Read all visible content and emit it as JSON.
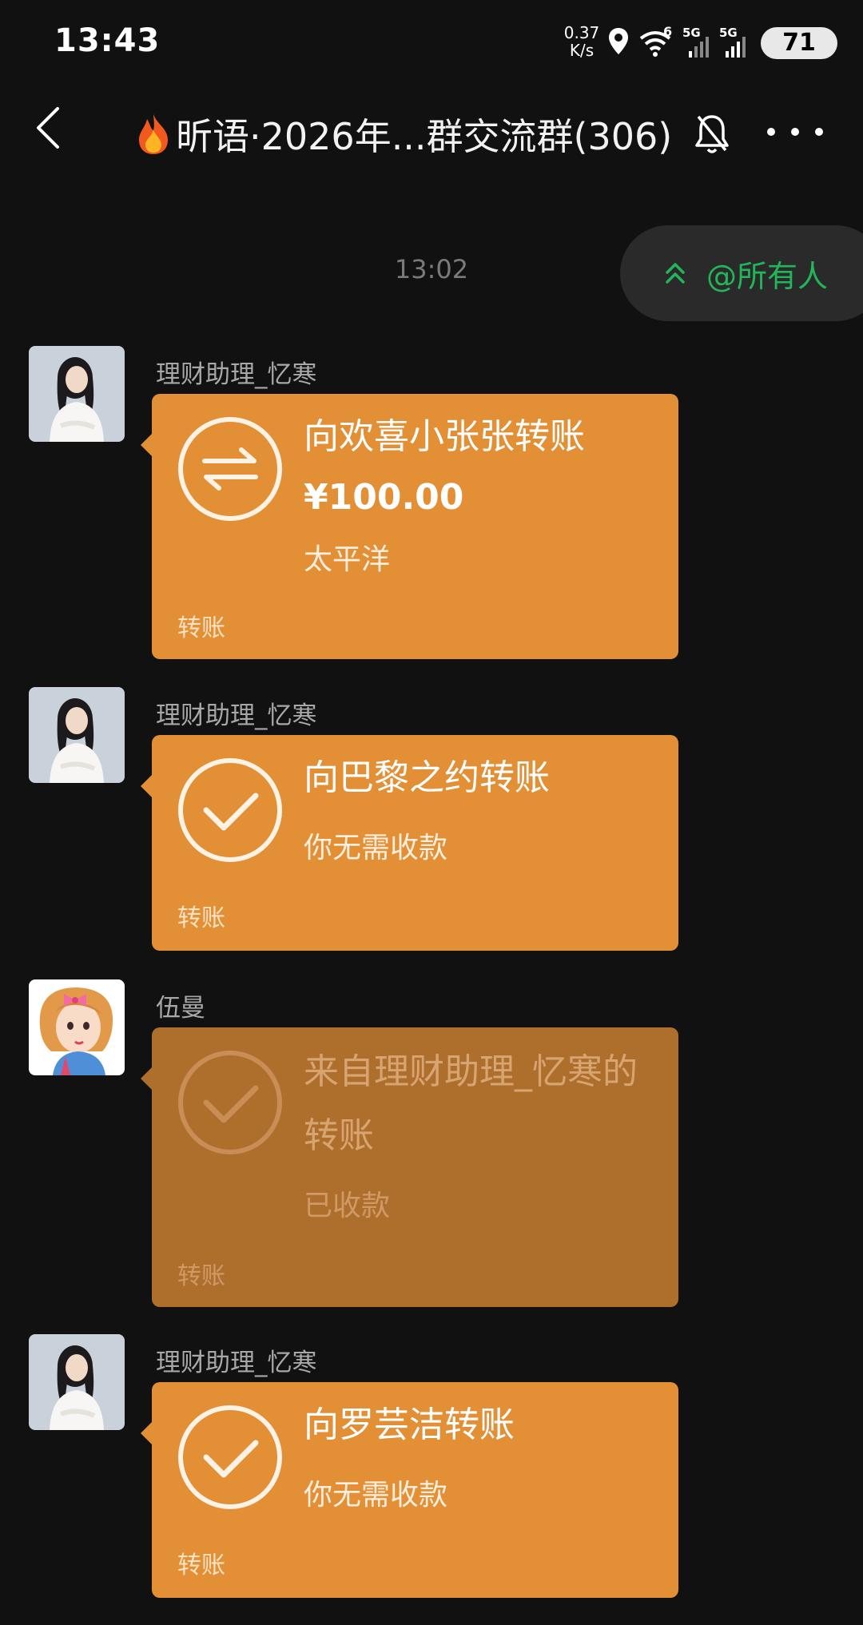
{
  "status_bar": {
    "time": "13:43",
    "net_speed_value": "0.37",
    "net_speed_unit": "K/s",
    "wifi_label": "6",
    "signal1_label": "5G",
    "signal2_label": "5G",
    "battery": "71"
  },
  "header": {
    "title": "昕语·2026年...群交流群(306)"
  },
  "mention": {
    "label": "@所有人",
    "color": "#22b55a"
  },
  "timestamp": "13:02",
  "colors": {
    "bubble": "#e28f35",
    "bubble_received": "#af6f2c",
    "background": "#111111"
  },
  "messages": [
    {
      "sender": "理财助理_忆寒",
      "title": "向欢喜小张张转账",
      "amount": "¥100.00",
      "subtitle": "太平洋",
      "footer": "转账",
      "icon": "transfer-arrows-icon"
    },
    {
      "sender": "理财助理_忆寒",
      "title": "向巴黎之约转账",
      "subtitle": "你无需收款",
      "footer": "转账",
      "icon": "check-circle-icon"
    },
    {
      "sender": "伍曼",
      "title": "来自理财助理_忆寒的转账",
      "subtitle": "已收款",
      "footer": "转账",
      "icon": "check-circle-icon"
    },
    {
      "sender": "理财助理_忆寒",
      "title": "向罗芸洁转账",
      "subtitle": "你无需收款",
      "footer": "转账",
      "icon": "check-circle-icon"
    }
  ]
}
